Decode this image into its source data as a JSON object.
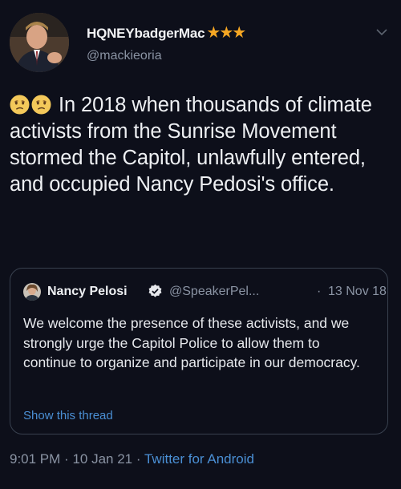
{
  "author": {
    "display_name": "HQNEYbadgerMac",
    "stars": "★★★",
    "handle": "@mackieoria"
  },
  "tweet": {
    "text": "In 2018 when thousands of climate activists from the Sunrise Movement stormed the Capitol, unlawfully entered, and occupied Nancy Pedosi's office.",
    "emojis": [
      "confused-face-emoji",
      "confused-face-emoji"
    ]
  },
  "quoted_tweet": {
    "author_name": "Nancy Pelosi",
    "handle": "@SpeakerPel...",
    "separator": "·",
    "date": "13 Nov 18",
    "text": "We welcome the presence of these activists, and we strongly urge the Capitol Police to allow them to continue to organize and participate in our democracy.",
    "show_thread": "Show this thread"
  },
  "meta": {
    "time": "9:01 PM",
    "sep1": "·",
    "date": "10 Jan 21",
    "sep2": "·",
    "source": "Twitter for Android"
  },
  "colors": {
    "background": "#0d0f1a",
    "link": "#4a8fd4",
    "star": "#f5a623",
    "verified": "#1d9bf0"
  }
}
